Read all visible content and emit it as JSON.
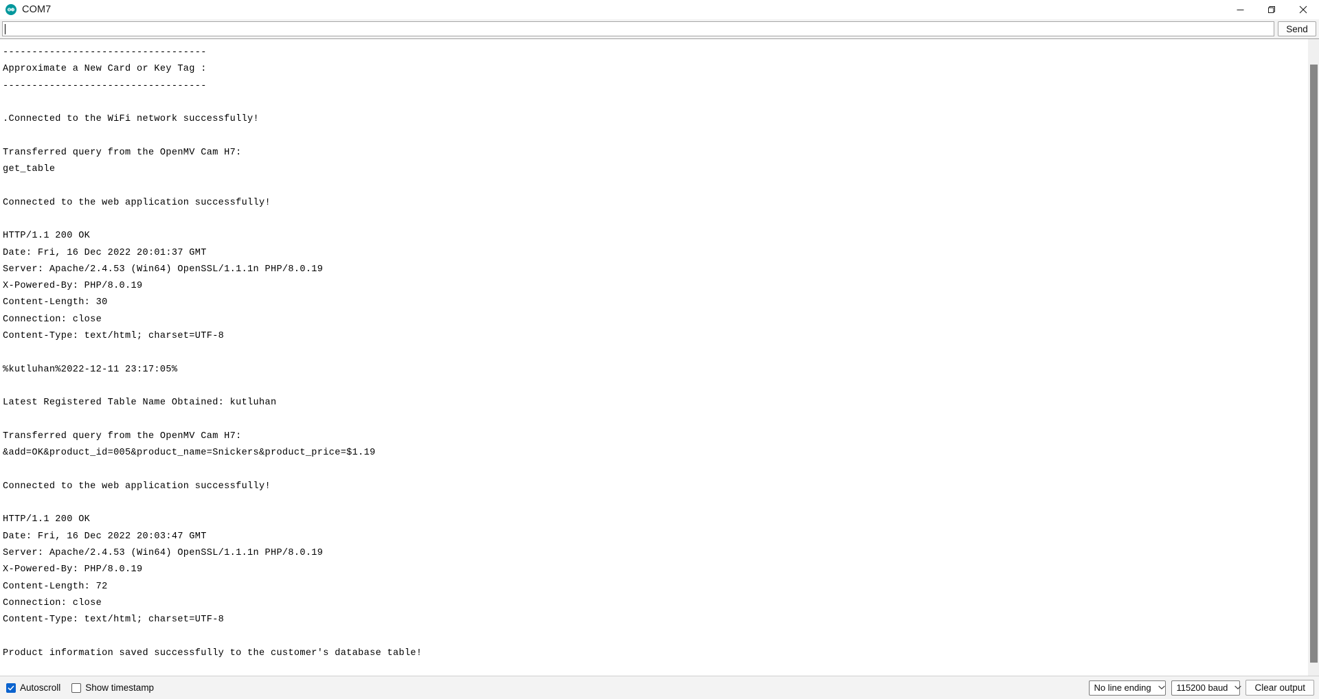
{
  "window": {
    "title": "COM7",
    "app_icon": "arduino-icon",
    "controls": {
      "minimize": "minimize-icon",
      "restore": "restore-icon",
      "close": "close-icon"
    }
  },
  "toolbar": {
    "input_value": "",
    "input_placeholder": "",
    "send_label": "Send"
  },
  "console": {
    "lines": [
      "-----------------------------------",
      "Approximate a New Card or Key Tag :",
      "-----------------------------------",
      "",
      ".Connected to the WiFi network successfully!",
      "",
      "Transferred query from the OpenMV Cam H7:",
      "get_table",
      "",
      "Connected to the web application successfully!",
      "",
      "HTTP/1.1 200 OK",
      "Date: Fri, 16 Dec 2022 20:01:37 GMT",
      "Server: Apache/2.4.53 (Win64) OpenSSL/1.1.1n PHP/8.0.19",
      "X-Powered-By: PHP/8.0.19",
      "Content-Length: 30",
      "Connection: close",
      "Content-Type: text/html; charset=UTF-8",
      "",
      "%kutluhan%2022-12-11 23:17:05%",
      "",
      "Latest Registered Table Name Obtained: kutluhan",
      "",
      "Transferred query from the OpenMV Cam H7:",
      "&add=OK&product_id=005&product_name=Snickers&product_price=$1.19",
      "",
      "Connected to the web application successfully!",
      "",
      "HTTP/1.1 200 OK",
      "Date: Fri, 16 Dec 2022 20:03:47 GMT",
      "Server: Apache/2.4.53 (Win64) OpenSSL/1.1.1n PHP/8.0.19",
      "X-Powered-By: PHP/8.0.19",
      "Content-Length: 72",
      "Connection: close",
      "Content-Type: text/html; charset=UTF-8",
      "",
      "Product information saved successfully to the customer's database table!"
    ]
  },
  "scrollbar": {
    "thumb_top_pct": 4,
    "thumb_height_pct": 94
  },
  "statusbar": {
    "autoscroll_label": "Autoscroll",
    "autoscroll_checked": true,
    "show_timestamp_label": "Show timestamp",
    "show_timestamp_checked": false,
    "line_ending_value": "No line ending",
    "baud_value": "115200 baud",
    "clear_output_label": "Clear output"
  },
  "colors": {
    "accent": "#0b63ce",
    "arduino_teal": "#00979C",
    "chrome": "#f3f3f3",
    "console_bg": "#ffffff",
    "text": "#000000",
    "scrollbar_thumb": "#868686"
  }
}
